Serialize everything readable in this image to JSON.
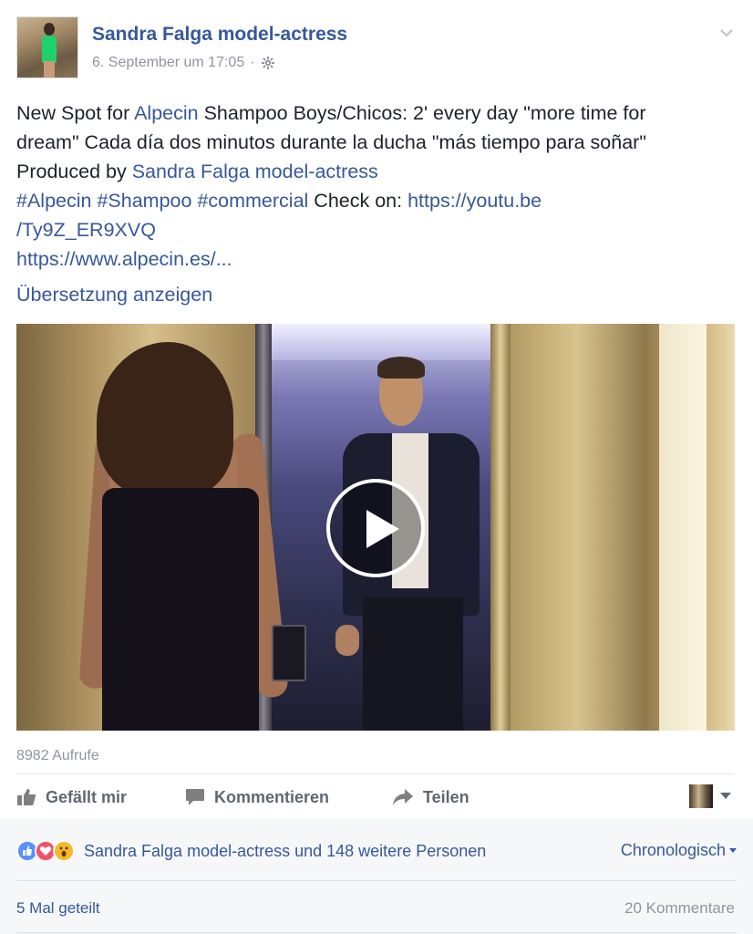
{
  "post": {
    "author": "Sandra Falga model-actress",
    "timestamp": "6. September um 17:05",
    "separator": "·",
    "text": {
      "line1_a": "New Spot for ",
      "line1_link": "Alpecin",
      "line1_b": " Shampoo Boys/Chicos: 2' every day \"more time for",
      "line2": "dream\" Cada día dos minutos durante la ducha \"más tiempo para soñar\"",
      "line3_a": "Produced by ",
      "line3_link": "Sandra Falga model-actress",
      "hashtag1": "#Alpecin",
      "hashtag2": "#Shampoo",
      "hashtag3": "#commercial",
      "check_on": " Check on: ",
      "url1a": "https://youtu.be",
      "url1b": "/Ty9Z_ER9XVQ",
      "url2": "https://www.alpecin.es/..."
    },
    "translate_label": "Übersetzung anzeigen",
    "views": "8982 Aufrufe"
  },
  "actions": {
    "like": "Gefällt mir",
    "comment": "Kommentieren",
    "share": "Teilen"
  },
  "reactions": {
    "summary": "Sandra Falga model-actress und 148 weitere Personen",
    "sort_label": "Chronologisch",
    "shares": "5 Mal geteilt",
    "comments": "20 Kommentare"
  },
  "colors": {
    "link": "#365899",
    "muted": "#90949c",
    "like": "#5890ff",
    "love": "#f25268",
    "wow": "#f7b928"
  }
}
